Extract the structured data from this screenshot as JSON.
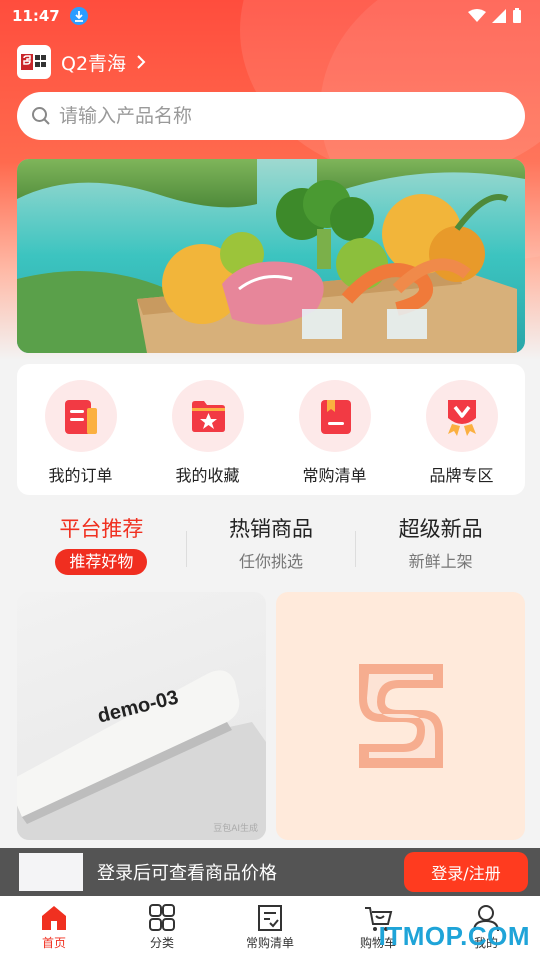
{
  "status": {
    "time": "11:47"
  },
  "store": {
    "name": "Q2青海"
  },
  "search": {
    "placeholder": "请输入产品名称"
  },
  "quick_menu": [
    {
      "label": "我的订单",
      "icon": "orders-icon"
    },
    {
      "label": "我的收藏",
      "icon": "favorites-icon"
    },
    {
      "label": "常购清单",
      "icon": "frequent-list-icon"
    },
    {
      "label": "品牌专区",
      "icon": "brand-zone-icon"
    }
  ],
  "tabs": [
    {
      "title": "平台推荐",
      "sub": "推荐好物"
    },
    {
      "title": "热销商品",
      "sub": "任你挑选"
    },
    {
      "title": "超级新品",
      "sub": "新鲜上架"
    }
  ],
  "products": [
    {
      "image_text": "demo-03",
      "tag": "豆包AI生成"
    },
    {
      "image": "brand-logo-placeholder"
    }
  ],
  "login_bar": {
    "text": "登录后可查看商品价格",
    "button": "登录/注册"
  },
  "bottom_nav": [
    {
      "label": "首页",
      "icon": "home-icon"
    },
    {
      "label": "分类",
      "icon": "category-icon"
    },
    {
      "label": "常购清单",
      "icon": "list-icon"
    },
    {
      "label": "购物车",
      "icon": "cart-icon"
    },
    {
      "label": "我的",
      "icon": "user-icon"
    }
  ],
  "watermark": "ITMOP.COM",
  "colors": {
    "primary": "#f03020",
    "accent": "#ff3b1f"
  }
}
